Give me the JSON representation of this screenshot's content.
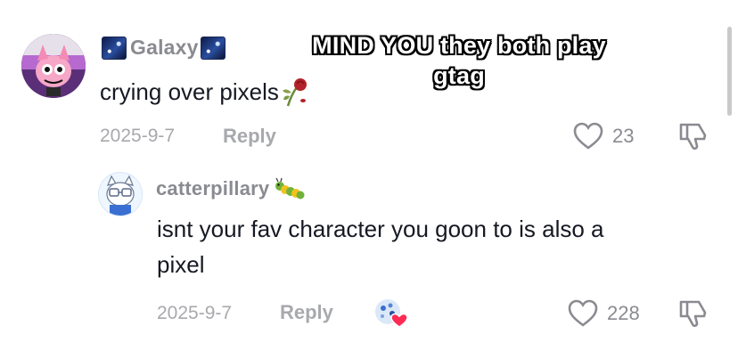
{
  "overlay_caption": {
    "line1": "MIND YOU they both play",
    "line2": "gtag"
  },
  "comment": {
    "username": "Galaxy",
    "text": "crying over pixels",
    "date": "2025-9-7",
    "reply_label": "Reply",
    "like_count": "23",
    "avatar_icon": "pink-cartoon-avatar",
    "emoji_icons": [
      "galaxy-emoji",
      "wilted-rose-emoji"
    ]
  },
  "reply": {
    "username": "catterpillary",
    "text_line1": "isnt your fav character you goon to is also a",
    "text_line2": "pixel",
    "date": "2025-9-7",
    "reply_label": "Reply",
    "like_count": "228",
    "avatar_icon": "cat-avatar",
    "emoji_icons": [
      "caterpillar-emoji"
    ],
    "creator_liked_badge": "creator-liked-avatar-heart"
  },
  "colors": {
    "muted": "#8a8b91",
    "text": "#161823",
    "heart_badge": "#fe2c55"
  }
}
